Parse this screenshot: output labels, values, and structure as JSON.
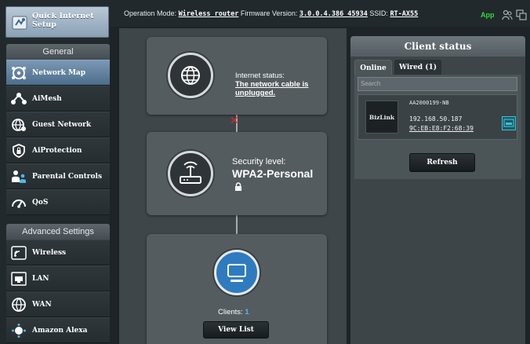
{
  "sidebar": {
    "quick_setup": "Quick Internet Setup",
    "general_header": "General",
    "general_items": [
      {
        "label": "Network Map",
        "icon": "network-map-icon",
        "active": true
      },
      {
        "label": "AiMesh",
        "icon": "aimesh-icon"
      },
      {
        "label": "Guest Network",
        "icon": "guest-network-icon"
      },
      {
        "label": "AiProtection",
        "icon": "aiprotection-icon"
      },
      {
        "label": "Parental Controls",
        "icon": "parental-controls-icon"
      },
      {
        "label": "QoS",
        "icon": "qos-icon"
      }
    ],
    "advanced_header": "Advanced Settings",
    "advanced_items": [
      {
        "label": "Wireless",
        "icon": "wireless-icon"
      },
      {
        "label": "LAN",
        "icon": "lan-icon"
      },
      {
        "label": "WAN",
        "icon": "wan-icon"
      },
      {
        "label": "Amazon Alexa",
        "icon": "alexa-icon"
      }
    ]
  },
  "topbar": {
    "mode_label": "Operation Mode:",
    "mode_value": "Wireless router",
    "firmware_label": "Firmware Version:",
    "firmware_value": "3.0.0.4.386_45934",
    "ssid_label": "SSID:",
    "ssid_value": "RT-AX55",
    "app_label": "App"
  },
  "map": {
    "internet_label": "Internet status:",
    "internet_value": "The network cable is unplugged.",
    "security_label": "Security level:",
    "security_value": "WPA2-Personal",
    "clients_label": "Clients:",
    "clients_count": "1",
    "view_list": "View List"
  },
  "client_status": {
    "title": "Client status",
    "tabs": [
      "Online",
      "Wired (1)"
    ],
    "search_placeholder": "Search",
    "client": {
      "vendor": "BizLink",
      "name": "AA2000199-NB",
      "ip": "192.168.50.187",
      "mac": "9C:EB:E8:F2:68:39"
    },
    "refresh": "Refresh"
  },
  "colors": {
    "active_item": "#5e7f9f",
    "app_green": "#35d93a",
    "client_count": "#4fb7e8",
    "disconnected_red": "#d8292f"
  }
}
